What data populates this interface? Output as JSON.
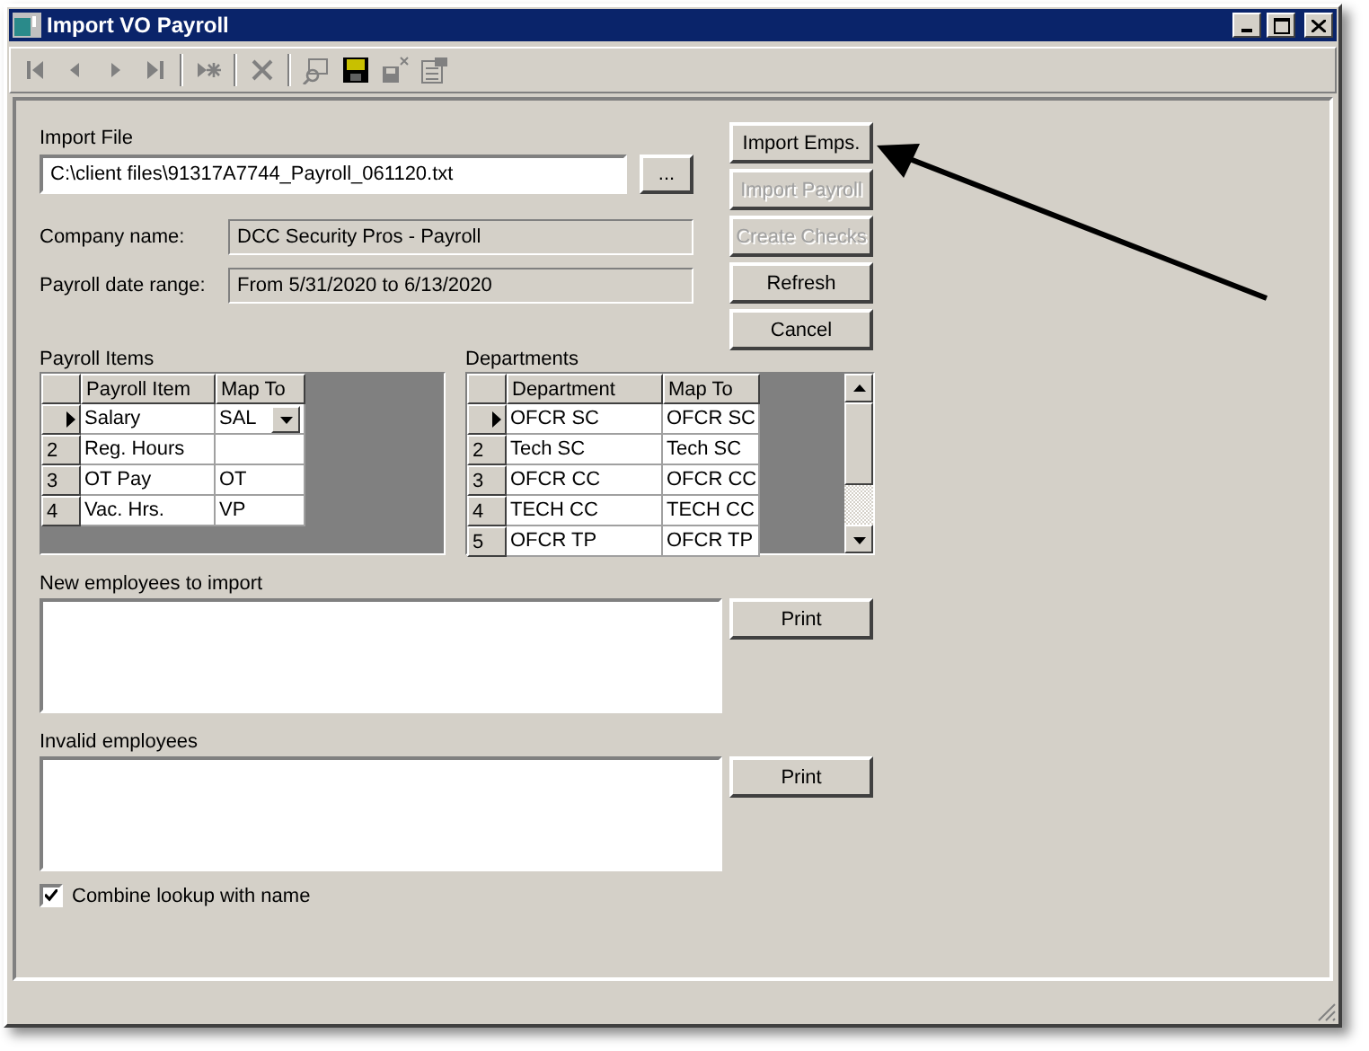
{
  "window": {
    "title": "Import VO Payroll"
  },
  "toolbar": [
    {
      "kind": "first",
      "disabled": true
    },
    {
      "kind": "prev",
      "disabled": true
    },
    {
      "kind": "next",
      "disabled": true
    },
    {
      "kind": "last",
      "disabled": true
    },
    {
      "kind": "sep"
    },
    {
      "kind": "new",
      "disabled": true
    },
    {
      "kind": "sep"
    },
    {
      "kind": "delete",
      "disabled": true
    },
    {
      "kind": "sep"
    },
    {
      "kind": "find",
      "disabled": true
    },
    {
      "kind": "save",
      "disabled": false
    },
    {
      "kind": "undo",
      "disabled": true
    },
    {
      "kind": "props",
      "disabled": true
    }
  ],
  "import_file": {
    "label": "Import File",
    "value": "C:\\client files\\91317A7744_Payroll_061120.txt",
    "browse": "..."
  },
  "info_fields": [
    {
      "label": "Company name:",
      "value": "DCC Security Pros - Payroll"
    },
    {
      "label": "Payroll date range:",
      "value": "From 5/31/2020 to 6/13/2020"
    }
  ],
  "buttons": [
    {
      "label": "Import Emps.",
      "disabled": false
    },
    {
      "label": "Import Payroll",
      "disabled": true
    },
    {
      "label": "Create Checks",
      "disabled": true
    },
    {
      "label": "Refresh",
      "disabled": false
    },
    {
      "label": "Cancel",
      "disabled": false
    }
  ],
  "payroll_items": {
    "label": "Payroll Items",
    "columns": [
      "Payroll Item",
      "Map To"
    ],
    "rows": [
      {
        "selected": true,
        "editing": true,
        "cells": [
          "Salary",
          "SAL"
        ]
      },
      {
        "selected": false,
        "editing": false,
        "row_header": "2",
        "cells": [
          "Reg. Hours",
          ""
        ]
      },
      {
        "selected": false,
        "editing": false,
        "row_header": "3",
        "cells": [
          "OT Pay",
          "OT"
        ]
      },
      {
        "selected": false,
        "editing": false,
        "row_header": "4",
        "cells": [
          "Vac. Hrs.",
          "VP"
        ]
      }
    ]
  },
  "departments": {
    "label": "Departments",
    "columns": [
      "Department",
      "Map To"
    ],
    "rows": [
      {
        "selected": true,
        "cells": [
          "OFCR SC",
          "OFCR SC"
        ]
      },
      {
        "selected": false,
        "row_header": "2",
        "cells": [
          "Tech SC",
          "Tech SC"
        ]
      },
      {
        "selected": false,
        "row_header": "3",
        "cells": [
          "OFCR CC",
          "OFCR CC"
        ]
      },
      {
        "selected": false,
        "row_header": "4",
        "cells": [
          "TECH CC",
          "TECH CC"
        ]
      },
      {
        "selected": false,
        "row_header": "5",
        "cells": [
          "OFCR TP",
          "OFCR TP"
        ]
      }
    ]
  },
  "lists": [
    {
      "label": "New employees to import",
      "button": "Print"
    },
    {
      "label": "Invalid employees",
      "button": "Print"
    }
  ],
  "combine_lookup": {
    "label": "Combine lookup with name",
    "checked": true
  }
}
